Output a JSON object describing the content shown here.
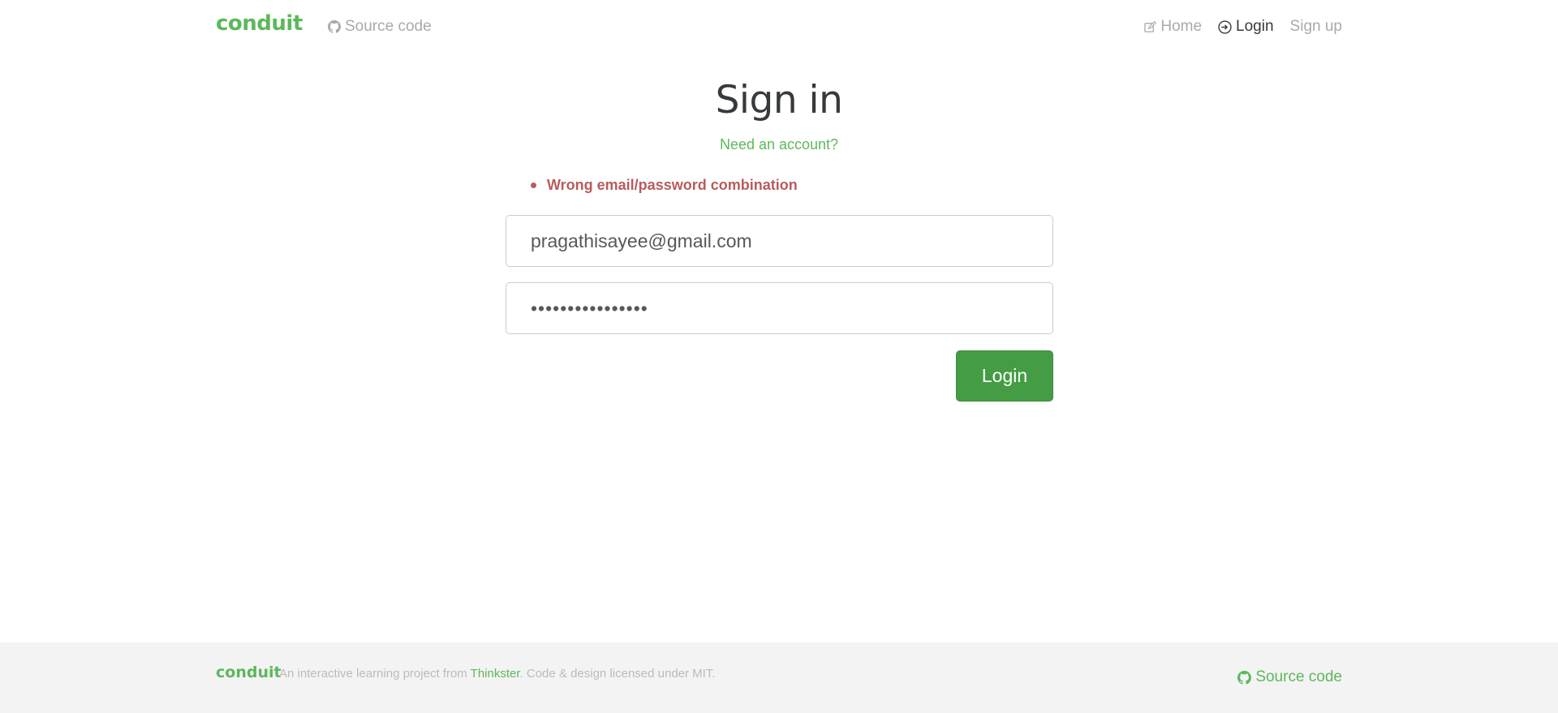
{
  "navbar": {
    "brand": "conduit",
    "source_code": "Source code",
    "links": {
      "home": "Home",
      "login": "Login",
      "signup": "Sign up"
    },
    "icons": {
      "source": "github-icon",
      "home": "edit-icon",
      "login": "sign-in-icon"
    }
  },
  "auth": {
    "title": "Sign in",
    "need_account": "Need an account?",
    "errors": [
      "Wrong email/password combination"
    ],
    "email_value": "pragathisayee@gmail.com",
    "password_value": "pragathisayee123",
    "submit_label": "Login"
  },
  "footer": {
    "brand": "conduit",
    "text_before": "An interactive learning project from ",
    "link": "Thinkster",
    "text_after": ". Code & design licensed under MIT.",
    "source_code": "Source code",
    "icons": {
      "source": "github-icon"
    }
  },
  "colors": {
    "brand": "#5cb85c",
    "error": "#b85c5c",
    "button": "#449d44",
    "muted": "#aaaaaa",
    "footer_bg": "#f3f3f3"
  }
}
